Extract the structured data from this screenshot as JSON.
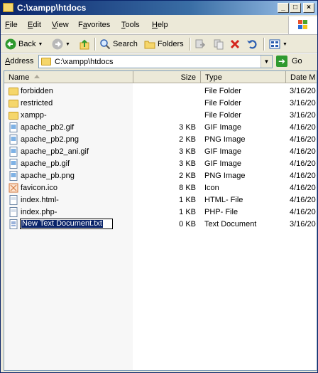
{
  "window": {
    "title": "C:\\xampp\\htdocs"
  },
  "menu": [
    "File",
    "Edit",
    "View",
    "Favorites",
    "Tools",
    "Help"
  ],
  "menu_mnemonic": [
    "F",
    "E",
    "V",
    "a",
    "T",
    "H"
  ],
  "toolbar": {
    "back_label": "Back",
    "search_label": "Search",
    "folders_label": "Folders",
    "icons": [
      "back-icon",
      "forward-icon",
      "up-icon",
      "search-icon",
      "folders-icon",
      "move-to-icon",
      "copy-to-icon",
      "delete-icon",
      "undo-icon",
      "views-icon"
    ]
  },
  "address": {
    "label": "Address",
    "value": "C:\\xampp\\htdocs",
    "go_label": "Go"
  },
  "columns": {
    "name": "Name",
    "size": "Size",
    "type": "Type",
    "date": "Date M"
  },
  "files": [
    {
      "name": "forbidden",
      "size": "",
      "type": "File Folder",
      "date": "3/16/20",
      "icon": "folder-icon"
    },
    {
      "name": "restricted",
      "size": "",
      "type": "File Folder",
      "date": "3/16/20",
      "icon": "folder-icon"
    },
    {
      "name": "xampp-",
      "size": "",
      "type": "File Folder",
      "date": "3/16/20",
      "icon": "folder-icon"
    },
    {
      "name": "apache_pb2.gif",
      "size": "3 KB",
      "type": "GIF Image",
      "date": "4/16/20",
      "icon": "image-file-icon"
    },
    {
      "name": "apache_pb2.png",
      "size": "2 KB",
      "type": "PNG Image",
      "date": "4/16/20",
      "icon": "image-file-icon"
    },
    {
      "name": "apache_pb2_ani.gif",
      "size": "3 KB",
      "type": "GIF Image",
      "date": "4/16/20",
      "icon": "image-file-icon"
    },
    {
      "name": "apache_pb.gif",
      "size": "3 KB",
      "type": "GIF Image",
      "date": "4/16/20",
      "icon": "image-file-icon"
    },
    {
      "name": "apache_pb.png",
      "size": "2 KB",
      "type": "PNG Image",
      "date": "4/16/20",
      "icon": "image-file-icon"
    },
    {
      "name": "favicon.ico",
      "size": "8 KB",
      "type": "Icon",
      "date": "4/16/20",
      "icon": "ico-file-icon"
    },
    {
      "name": "index.html-",
      "size": "1 KB",
      "type": "HTML- File",
      "date": "4/16/20",
      "icon": "generic-file-icon"
    },
    {
      "name": "index.php-",
      "size": "1 KB",
      "type": "PHP- File",
      "date": "4/16/20",
      "icon": "generic-file-icon"
    },
    {
      "name": "New Text Document.txt",
      "size": "0 KB",
      "type": "Text Document",
      "date": "3/16/20",
      "icon": "text-file-icon",
      "renaming": true
    }
  ],
  "colors": {
    "title_bar": "#0a246a",
    "selection": "#0a246a",
    "folder": "#f5d66b"
  }
}
